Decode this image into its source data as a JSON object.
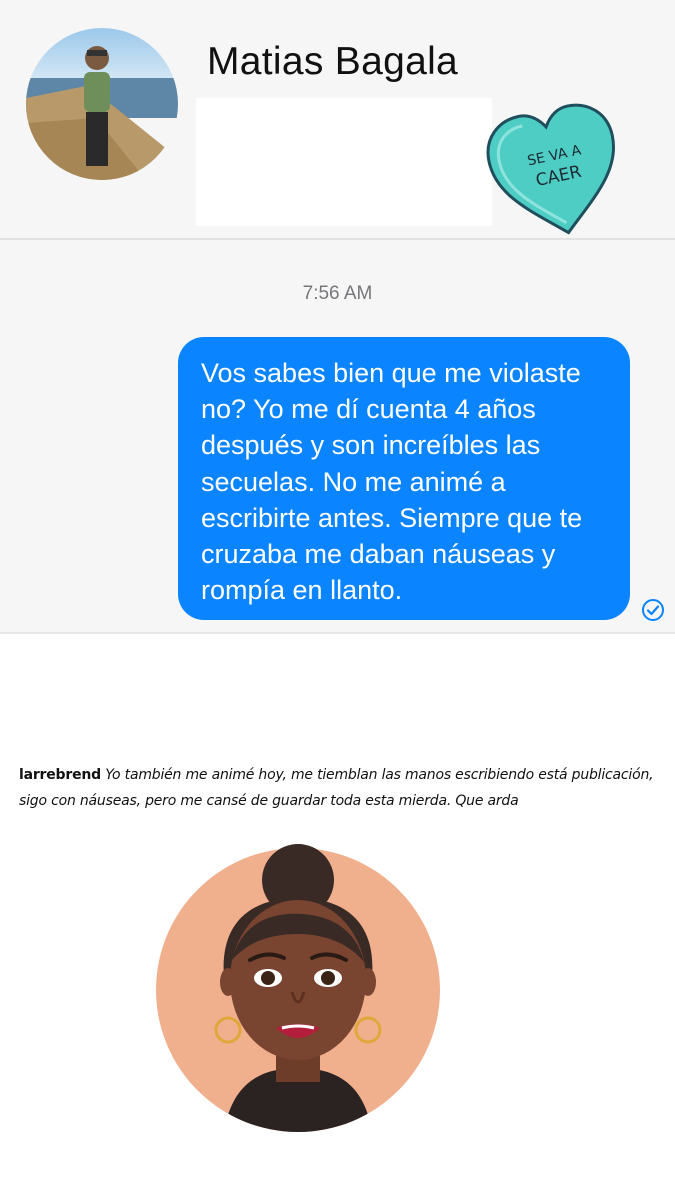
{
  "header": {
    "contact_name": "Matias Bagala",
    "sticker_text_line1": "SE VA A",
    "sticker_text_line2": "CAER",
    "sticker_color": "#4ecdc4"
  },
  "conversation": {
    "timestamp": "7:56 AM",
    "message": "Vos sabes bien que me violaste no? Yo me dí cuenta 4 años después y son increíbles las secuelas. No me animé a escribirte antes. Siempre que te cruzaba me daban náuseas y rompía en llanto.",
    "bubble_color": "#0a84ff",
    "status_icon": "sent-check-icon"
  },
  "comment": {
    "username": "larrebrend",
    "text": "Yo también me animé hoy, me tiemblan las manos escribiendo está publicación, sigo con náuseas, pero me cansé de guardar toda esta mierda. Que arda"
  },
  "icons": [
    "contact-avatar",
    "heart-sticker",
    "sent-check-icon",
    "woman-avatar"
  ]
}
